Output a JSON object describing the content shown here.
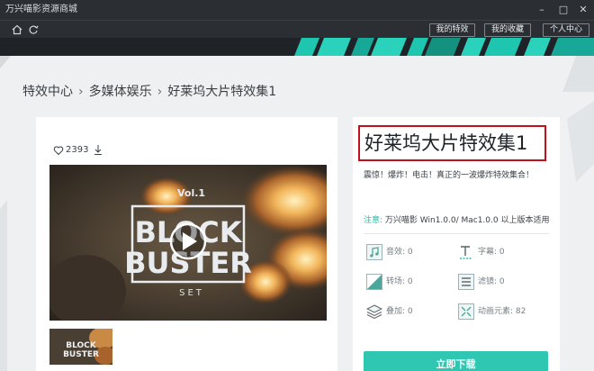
{
  "window": {
    "title": "万兴喵影资源商城",
    "controls": [
      "minimize",
      "maximize",
      "close"
    ]
  },
  "nav": {
    "home_icon": "home-icon",
    "refresh_icon": "refresh-icon",
    "buttons": [
      "我的特效",
      "我的收藏",
      "个人中心"
    ]
  },
  "breadcrumb": [
    "特效中心",
    "多媒体娱乐",
    "好莱坞大片特效集1"
  ],
  "product": {
    "likes": "2393",
    "title": "好莱坞大片特效集1",
    "description": "震惊！爆炸！电击！真正的一波爆炸特效集合！",
    "compat_label": "注意:",
    "compat_text": "万兴喵影 Win1.0.0/ Mac1.0.0 以上版本适用",
    "preview": {
      "vol": "Vol.1",
      "line1": "BLOCK",
      "line2": "BUSTER",
      "line3": "SET"
    },
    "features": [
      {
        "icon": "music-note-icon",
        "label": "音效:",
        "value": "0"
      },
      {
        "icon": "text-icon",
        "label": "字幕:",
        "value": "0"
      },
      {
        "icon": "transition-icon",
        "label": "转场:",
        "value": "0"
      },
      {
        "icon": "filter-icon",
        "label": "滤镜:",
        "value": "0"
      },
      {
        "icon": "overlay-icon",
        "label": "叠加:",
        "value": "0"
      },
      {
        "icon": "animation-element-icon",
        "label": "动画元素:",
        "value": "82"
      }
    ],
    "download_label": "立即下载"
  },
  "colors": {
    "accent": "#2fc7b2",
    "highlight_border": "#c0121c",
    "titlebar": "#2b2f33"
  }
}
